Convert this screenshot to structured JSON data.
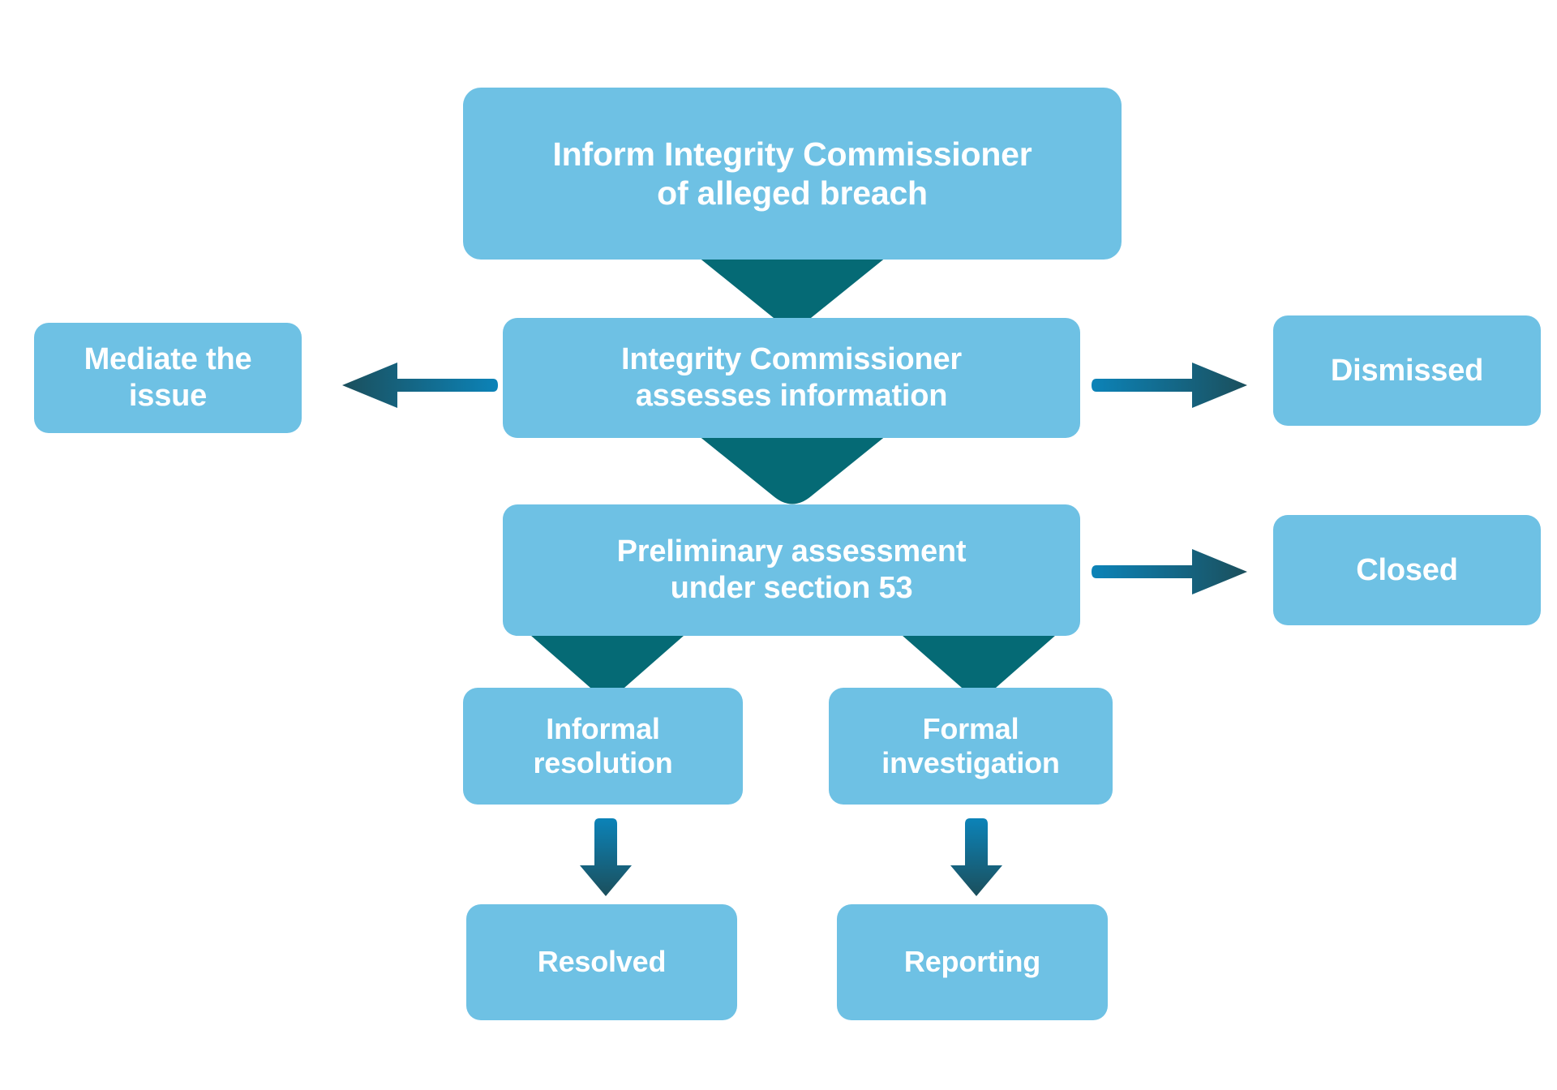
{
  "diagram": {
    "title": "Integrity Commissioner alleged breach process flowchart",
    "colors": {
      "node_fill": "#6EC1E4",
      "node_text": "#FFFFFF",
      "connector_dark": "#056A75",
      "arrow_gradient_start": "#0C83B8",
      "arrow_gradient_end": "#1B4F5C",
      "background": "#FFFFFF"
    },
    "nodes": {
      "inform": "Inform Integrity Commissioner\nof alleged breach",
      "assess": "Integrity Commissioner\nassesses information",
      "preliminary": "Preliminary assessment\nunder section 53",
      "mediate": "Mediate the\nissue",
      "dismissed": "Dismissed",
      "closed": "Closed",
      "informal": "Informal\nresolution",
      "formal": "Formal\ninvestigation",
      "resolved": "Resolved",
      "reporting": "Reporting"
    },
    "connectors": [
      {
        "name": "inform-to-assess",
        "type": "chevron-down"
      },
      {
        "name": "assess-to-preliminary",
        "type": "chevron-down"
      },
      {
        "name": "assess-to-mediate",
        "type": "arrow-left"
      },
      {
        "name": "assess-to-dismissed",
        "type": "arrow-right"
      },
      {
        "name": "preliminary-to-closed",
        "type": "arrow-right"
      },
      {
        "name": "preliminary-to-informal",
        "type": "chevron-down"
      },
      {
        "name": "preliminary-to-formal",
        "type": "chevron-down"
      },
      {
        "name": "informal-to-resolved",
        "type": "arrow-down"
      },
      {
        "name": "formal-to-reporting",
        "type": "arrow-down"
      }
    ]
  }
}
